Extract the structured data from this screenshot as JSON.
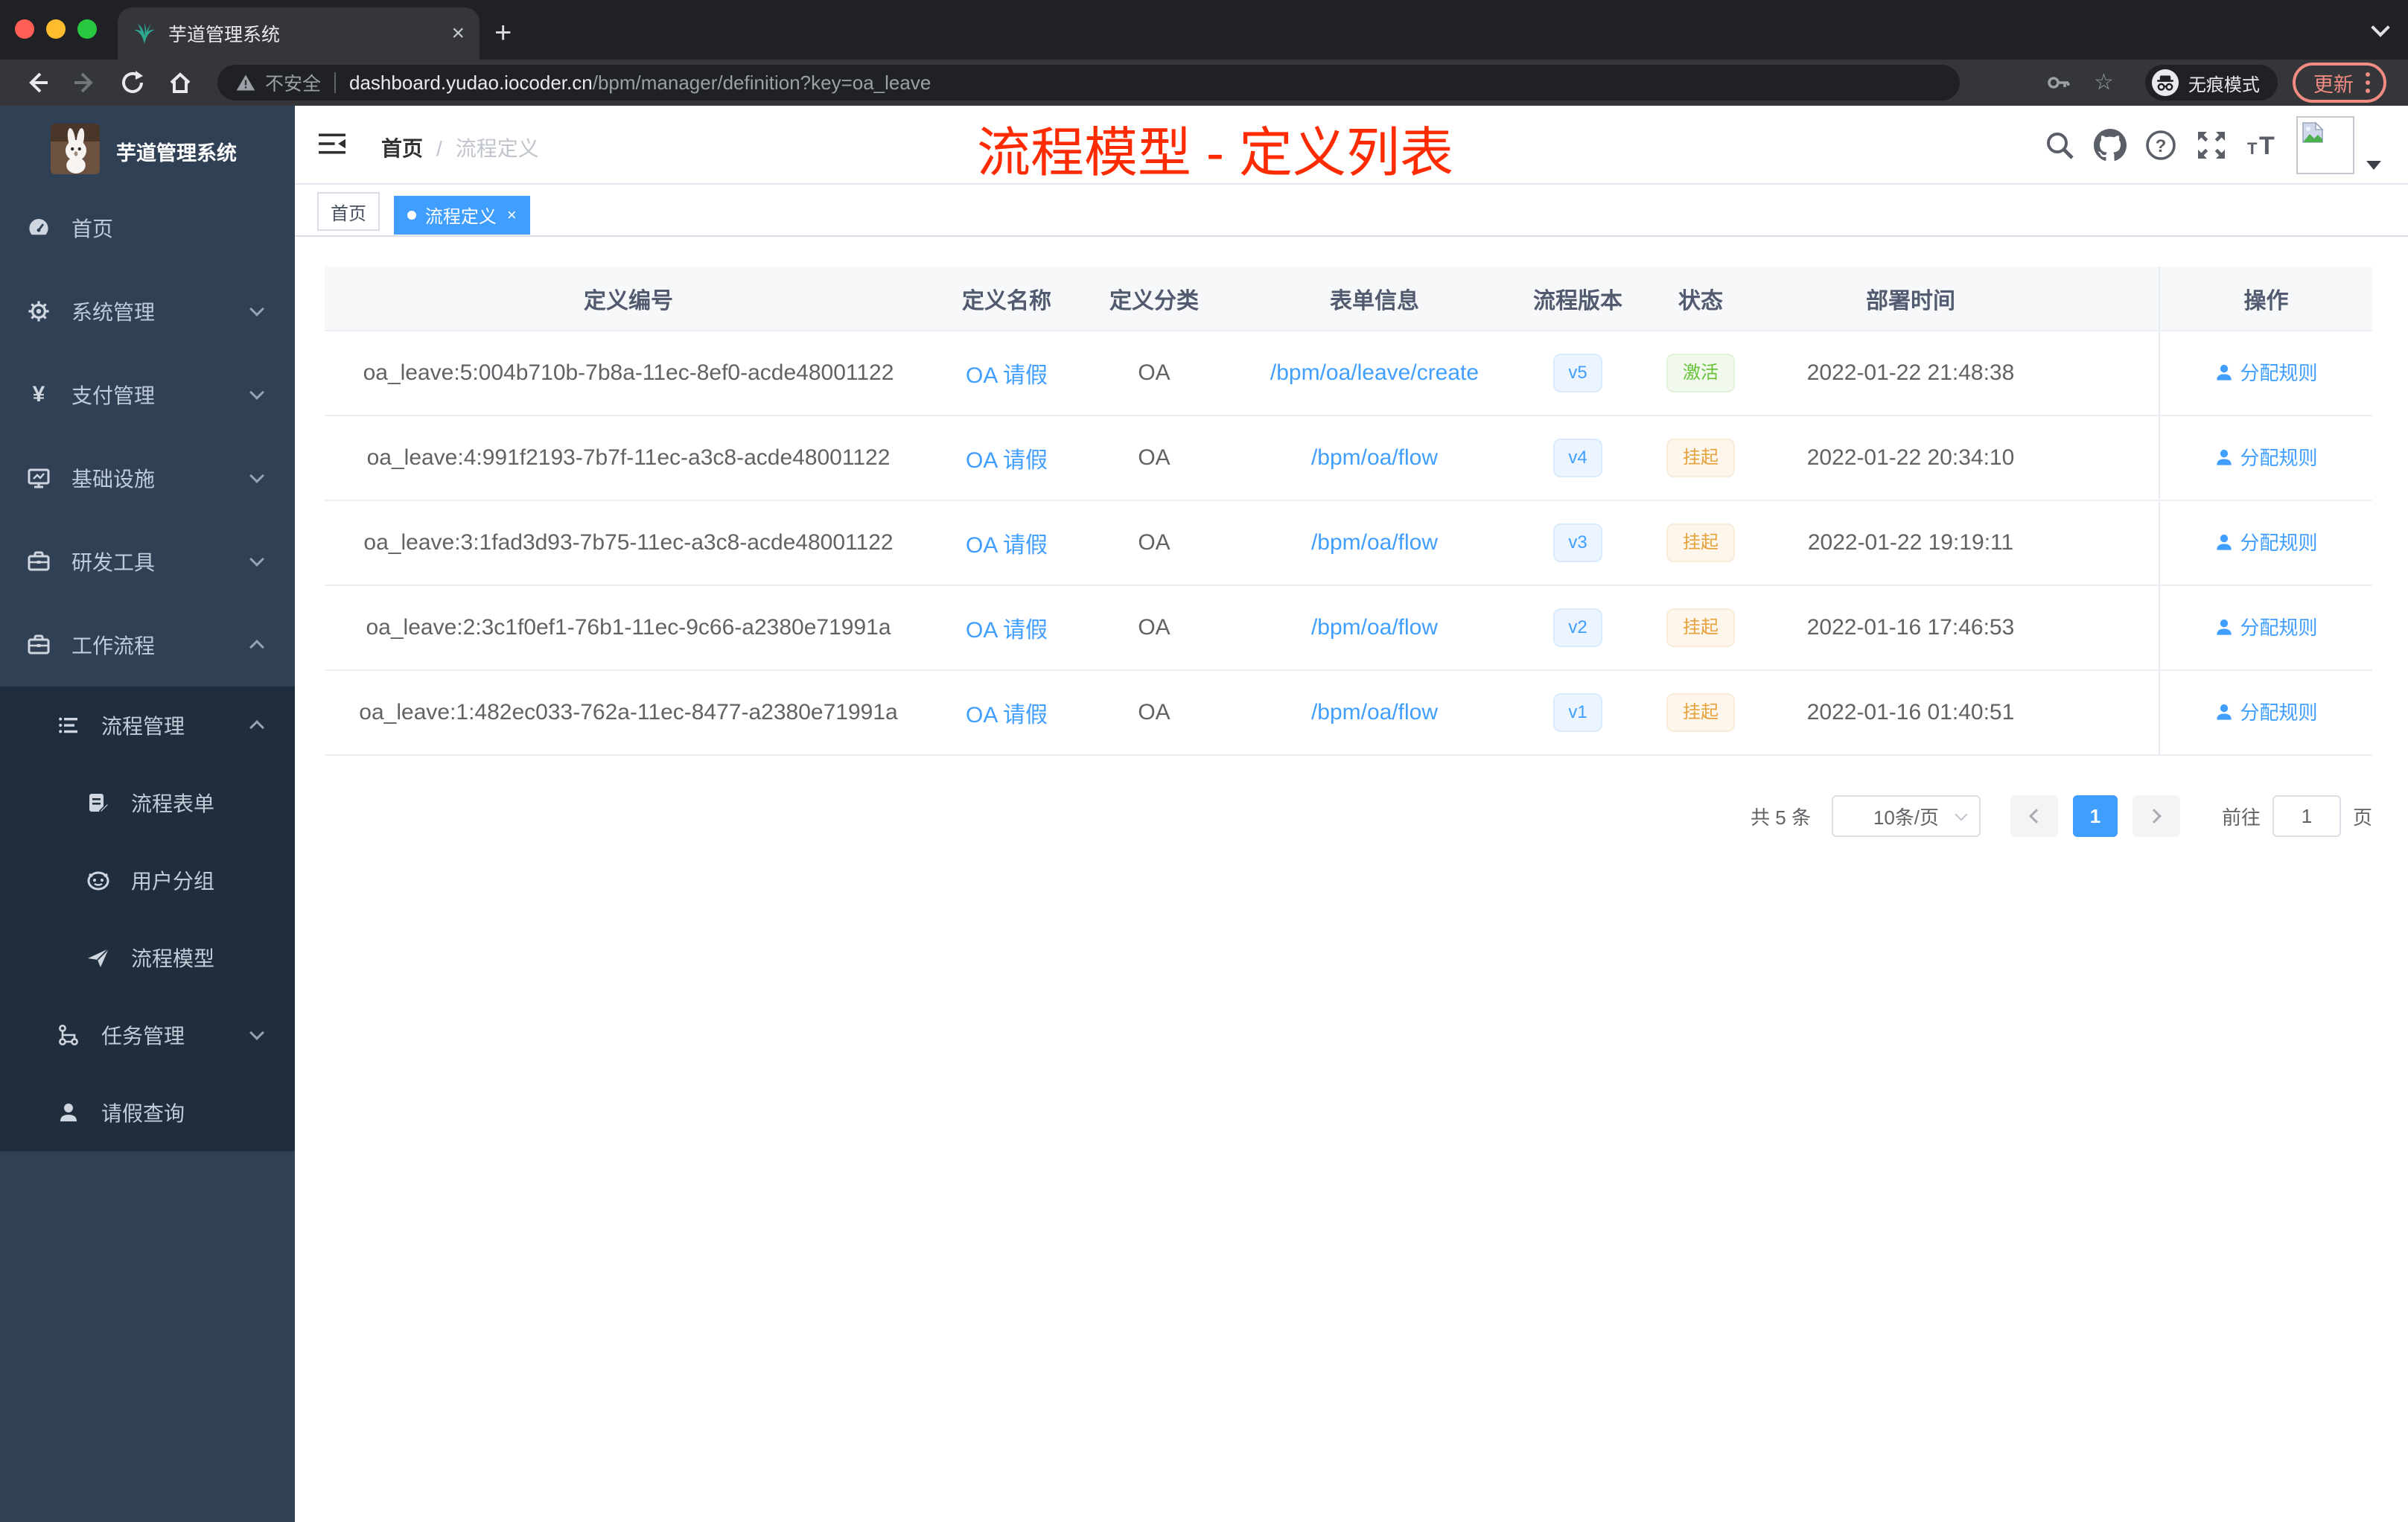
{
  "browser": {
    "tab_title": "芋道管理系统",
    "security_label": "不安全",
    "url_host": "dashboard.yudao.iocoder.cn",
    "url_path": "/bpm/manager/definition?key=oa_leave",
    "incognito_label": "无痕模式",
    "update_label": "更新"
  },
  "sidebar": {
    "logo_title": "芋道管理系统",
    "items": [
      {
        "label": "首页"
      },
      {
        "label": "系统管理"
      },
      {
        "label": "支付管理"
      },
      {
        "label": "基础设施"
      },
      {
        "label": "研发工具"
      },
      {
        "label": "工作流程"
      }
    ],
    "subitems": [
      {
        "label": "流程管理"
      },
      {
        "label": "流程表单"
      },
      {
        "label": "用户分组"
      },
      {
        "label": "流程模型"
      },
      {
        "label": "任务管理"
      },
      {
        "label": "请假查询"
      }
    ]
  },
  "navbar": {
    "breadcrumb_home": "首页",
    "breadcrumb_current": "流程定义"
  },
  "page_title": "流程模型 - 定义列表",
  "tags": {
    "home": "首页",
    "current": "流程定义"
  },
  "table": {
    "headers": [
      "定义编号",
      "定义名称",
      "定义分类",
      "表单信息",
      "流程版本",
      "状态",
      "部署时间",
      "操作"
    ],
    "rows": [
      {
        "id": "oa_leave:5:004b710b-7b8a-11ec-8ef0-acde48001122",
        "name": "OA 请假",
        "category": "OA",
        "form": "/bpm/oa/leave/create",
        "version": "v5",
        "status": "激活",
        "time": "2022-01-22 21:48:38",
        "action": "分配规则"
      },
      {
        "id": "oa_leave:4:991f2193-7b7f-11ec-a3c8-acde48001122",
        "name": "OA 请假",
        "category": "OA",
        "form": "/bpm/oa/flow",
        "version": "v4",
        "status": "挂起",
        "time": "2022-01-22 20:34:10",
        "action": "分配规则"
      },
      {
        "id": "oa_leave:3:1fad3d93-7b75-11ec-a3c8-acde48001122",
        "name": "OA 请假",
        "category": "OA",
        "form": "/bpm/oa/flow",
        "version": "v3",
        "status": "挂起",
        "time": "2022-01-22 19:19:11",
        "action": "分配规则"
      },
      {
        "id": "oa_leave:2:3c1f0ef1-76b1-11ec-9c66-a2380e71991a",
        "name": "OA 请假",
        "category": "OA",
        "form": "/bpm/oa/flow",
        "version": "v2",
        "status": "挂起",
        "time": "2022-01-16 17:46:53",
        "action": "分配规则"
      },
      {
        "id": "oa_leave:1:482ec033-762a-11ec-8477-a2380e71991a",
        "name": "OA 请假",
        "category": "OA",
        "form": "/bpm/oa/flow",
        "version": "v1",
        "status": "挂起",
        "time": "2022-01-16 01:40:51",
        "action": "分配规则"
      }
    ]
  },
  "pagination": {
    "total": "共 5 条",
    "page_size": "10条/页",
    "current_page": "1",
    "goto_label": "前往",
    "page_label": "页"
  }
}
